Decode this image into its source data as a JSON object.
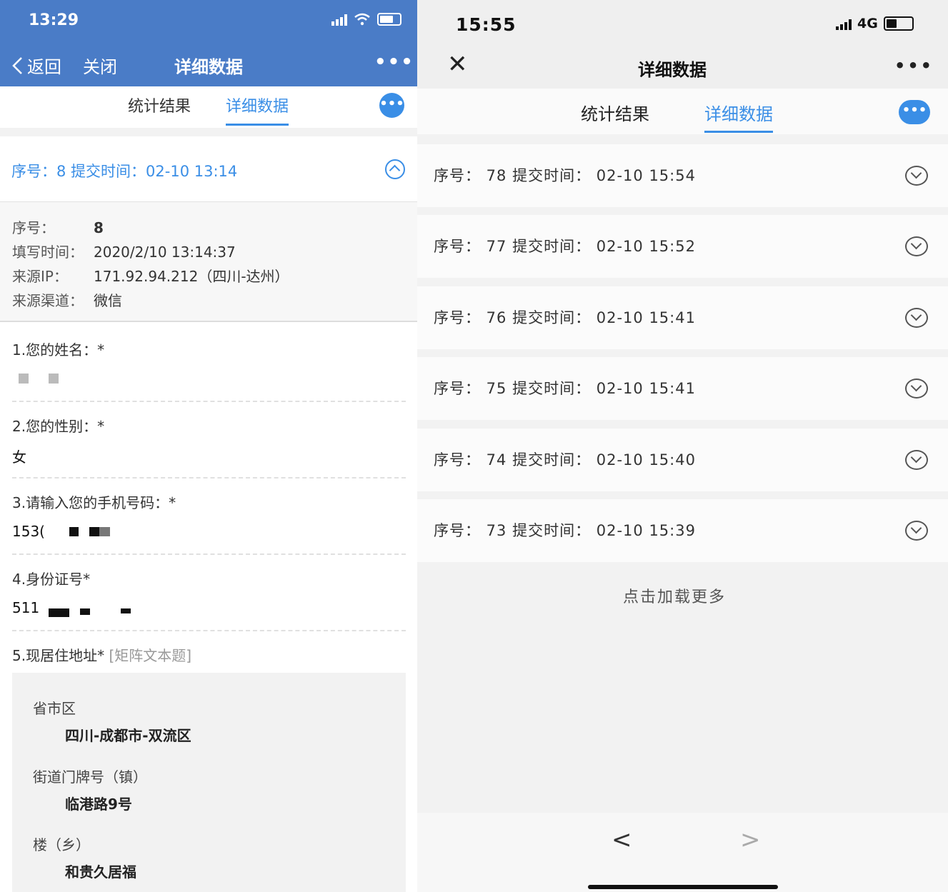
{
  "left": {
    "status": {
      "time": "13:29"
    },
    "nav": {
      "back": "返回",
      "close": "关闭",
      "title": "详细数据",
      "more": "•••"
    },
    "tabs": {
      "stats": "统计结果",
      "detail": "详细数据",
      "bubble": "•••"
    },
    "entry_summary": "序号：8  提交时间：02-10 13:14",
    "meta": [
      {
        "key": "序号：",
        "value": "8"
      },
      {
        "key": "填写时间：",
        "value": "2020/2/10 13:14:37"
      },
      {
        "key": "来源IP：",
        "value": "171.92.94.212（四川-达州）"
      },
      {
        "key": "来源渠道：",
        "value": "微信"
      }
    ],
    "questions": {
      "q1": "1.您的姓名：*",
      "q2": "2.您的性别：*",
      "q2_answer": "女",
      "q3": "3.请输入您的手机号码：*",
      "q3_answer": "153(",
      "q4": "4.身份证号*",
      "q4_answer": "511",
      "q5": "5.现居住地址*",
      "q5_tag": "[矩阵文本题]"
    },
    "address": [
      {
        "label": "省市区",
        "value": "四川-成都市-双流区"
      },
      {
        "label": "街道门牌号（镇）",
        "value": "临港路9号"
      },
      {
        "label": "楼（乡）",
        "value": "和贵久居福"
      }
    ]
  },
  "right": {
    "status": {
      "time": "15:55",
      "network": "4G"
    },
    "nav": {
      "close": "✕",
      "title": "详细数据",
      "more": "•••"
    },
    "tabs": {
      "stats": "统计结果",
      "detail": "详细数据",
      "bubble": "•••"
    },
    "rows": [
      "序号：  78   提交时间：  02-10 15:54",
      "序号：  77   提交时间：  02-10 15:52",
      "序号：  76   提交时间：  02-10 15:41",
      "序号：  75   提交时间：  02-10 15:41",
      "序号：  74   提交时间：  02-10 15:40",
      "序号：  73   提交时间：  02-10 15:39"
    ],
    "load_more": "点击加载更多",
    "pager": {
      "prev": "<",
      "next": ">"
    }
  },
  "colors": {
    "nav_blue": "#4a7cc7",
    "accent": "#3a8ee6"
  }
}
